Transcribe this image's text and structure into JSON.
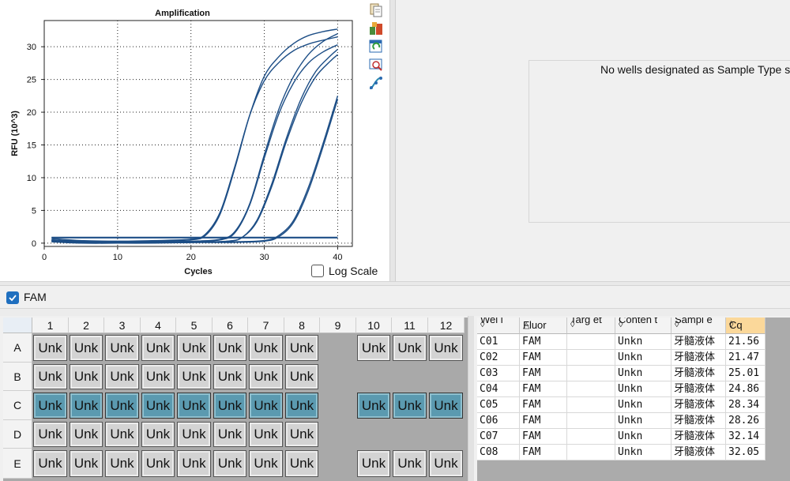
{
  "chart_data": {
    "type": "line",
    "title": "Amplification",
    "xlabel": "Cycles",
    "ylabel": "RFU (10^3)",
    "xlim": [
      0,
      42
    ],
    "ylim": [
      -0.5,
      34
    ],
    "xticks": [
      0,
      10,
      20,
      30,
      40
    ],
    "yticks": [
      0,
      5,
      10,
      15,
      20,
      25,
      30
    ],
    "grid": true,
    "line_color": "#1d4e86",
    "series": [
      {
        "cq": 21.56,
        "plateau": 33.0,
        "x": [
          1,
          5,
          10,
          15,
          20,
          22,
          24,
          26,
          28,
          30,
          32,
          34,
          36,
          38,
          40
        ],
        "y": [
          0.4,
          0.2,
          0.2,
          0.3,
          0.5,
          1.2,
          4.5,
          11.5,
          19.5,
          25.5,
          28.5,
          30.5,
          31.7,
          32.3,
          32.7
        ]
      },
      {
        "cq": 21.47,
        "plateau": 31.5,
        "x": [
          1,
          5,
          10,
          15,
          20,
          22,
          24,
          26,
          28,
          30,
          32,
          34,
          36,
          38,
          40
        ],
        "y": [
          0.7,
          0.4,
          0.3,
          0.4,
          0.6,
          1.4,
          4.8,
          11.8,
          19.5,
          24.8,
          27.6,
          29.4,
          30.4,
          31.0,
          31.5
        ]
      },
      {
        "cq": 25.01,
        "plateau": 32.3,
        "x": [
          1,
          5,
          10,
          15,
          20,
          24,
          26,
          28,
          30,
          32,
          34,
          36,
          38,
          40
        ],
        "y": [
          0.5,
          0.2,
          0.2,
          0.2,
          0.3,
          0.6,
          1.8,
          6.0,
          13.5,
          20.5,
          25.5,
          28.8,
          30.8,
          32.0
        ]
      },
      {
        "cq": 24.86,
        "plateau": 30.3,
        "x": [
          1,
          5,
          10,
          15,
          20,
          24,
          26,
          28,
          30,
          32,
          34,
          36,
          38,
          40
        ],
        "y": [
          0.4,
          0.1,
          0.1,
          0.1,
          0.2,
          0.5,
          1.6,
          5.8,
          13.0,
          19.8,
          24.5,
          27.5,
          29.2,
          30.3
        ]
      },
      {
        "cq": 28.34,
        "plateau": 30.0,
        "x": [
          1,
          5,
          10,
          15,
          20,
          25,
          27,
          29,
          31,
          33,
          35,
          37,
          39,
          40
        ],
        "y": [
          0.3,
          0.1,
          0.1,
          0.1,
          0.1,
          0.3,
          0.9,
          3.5,
          9.0,
          16.0,
          22.0,
          26.2,
          28.6,
          29.6
        ]
      },
      {
        "cq": 28.26,
        "plateau": 29.2,
        "x": [
          1,
          5,
          10,
          15,
          20,
          25,
          27,
          29,
          31,
          33,
          35,
          37,
          39,
          40
        ],
        "y": [
          0.2,
          0.0,
          0.0,
          0.1,
          0.1,
          0.3,
          0.9,
          3.3,
          8.6,
          15.5,
          21.3,
          25.4,
          27.8,
          28.8
        ]
      },
      {
        "cq": 32.14,
        "plateau": 22.5,
        "x": [
          1,
          5,
          10,
          15,
          20,
          25,
          30,
          32,
          34,
          36,
          38,
          40
        ],
        "y": [
          0.5,
          0.3,
          0.2,
          0.2,
          0.2,
          0.2,
          0.4,
          1.2,
          3.5,
          8.5,
          15.2,
          22.5
        ]
      },
      {
        "cq": 32.05,
        "plateau": 22.0,
        "x": [
          1,
          5,
          10,
          15,
          20,
          25,
          30,
          32,
          34,
          36,
          38,
          40
        ],
        "y": [
          0.3,
          0.1,
          0.0,
          0.0,
          0.1,
          0.1,
          0.3,
          1.0,
          3.2,
          8.0,
          14.7,
          22.0
        ]
      },
      {
        "cq": null,
        "plateau": 0.8,
        "x": [
          1,
          40
        ],
        "y": [
          0.8,
          0.8
        ]
      },
      {
        "cq": null,
        "plateau": 0.9,
        "x": [
          1,
          40
        ],
        "y": [
          0.9,
          0.9
        ]
      }
    ]
  },
  "toolbar_icons": [
    "copy-icon",
    "export-icon",
    "refresh-icon",
    "zoom-chart-icon",
    "curve-icon"
  ],
  "log_scale": {
    "label": "Log Scale",
    "checked": false
  },
  "message": "No wells designated as Sample Type s",
  "fluor_filter": {
    "label": "FAM",
    "checked": true
  },
  "plate": {
    "columns": [
      "1",
      "2",
      "3",
      "4",
      "5",
      "6",
      "7",
      "8",
      "9",
      "10",
      "11",
      "12"
    ],
    "rows": [
      "A",
      "B",
      "C",
      "D",
      "E"
    ],
    "well_label": "Unk",
    "wells": [
      [
        "Unk",
        "Unk",
        "Unk",
        "Unk",
        "Unk",
        "Unk",
        "Unk",
        "Unk",
        "",
        "Unk",
        "Unk",
        "Unk"
      ],
      [
        "Unk",
        "Unk",
        "Unk",
        "Unk",
        "Unk",
        "Unk",
        "Unk",
        "Unk",
        "",
        "",
        "",
        ""
      ],
      [
        "Unk",
        "Unk",
        "Unk",
        "Unk",
        "Unk",
        "Unk",
        "Unk",
        "Unk",
        "",
        "Unk",
        "Unk",
        "Unk"
      ],
      [
        "Unk",
        "Unk",
        "Unk",
        "Unk",
        "Unk",
        "Unk",
        "Unk",
        "Unk",
        "",
        "",
        "",
        ""
      ],
      [
        "Unk",
        "Unk",
        "Unk",
        "Unk",
        "Unk",
        "Unk",
        "Unk",
        "Unk",
        "",
        "Unk",
        "Unk",
        "Unk"
      ]
    ],
    "selected_row": 2,
    "selected_color": "#5b9ab0"
  },
  "table": {
    "headers": [
      {
        "label": "Wel l",
        "arrow": "◊"
      },
      {
        "label": "Fluor",
        "arrow": "△"
      },
      {
        "label": "Targ et",
        "arrow": "◊"
      },
      {
        "label": "Conten t",
        "arrow": "◊"
      },
      {
        "label": "Sampl e",
        "arrow": "◊"
      },
      {
        "label": "Cq",
        "arrow": "◊"
      }
    ],
    "rows": [
      [
        "C01",
        "FAM",
        "",
        "Unkn",
        "牙髓液体",
        "21.56"
      ],
      [
        "C02",
        "FAM",
        "",
        "Unkn",
        "牙髓液体",
        "21.47"
      ],
      [
        "C03",
        "FAM",
        "",
        "Unkn",
        "牙髓液体",
        "25.01"
      ],
      [
        "C04",
        "FAM",
        "",
        "Unkn",
        "牙髓液体",
        "24.86"
      ],
      [
        "C05",
        "FAM",
        "",
        "Unkn",
        "牙髓液体",
        "28.34"
      ],
      [
        "C06",
        "FAM",
        "",
        "Unkn",
        "牙髓液体",
        "28.26"
      ],
      [
        "C07",
        "FAM",
        "",
        "Unkn",
        "牙髓液体",
        "32.14"
      ],
      [
        "C08",
        "FAM",
        "",
        "Unkn",
        "牙髓液体",
        "32.05"
      ]
    ],
    "cq_header_color": "#fbd89a"
  }
}
